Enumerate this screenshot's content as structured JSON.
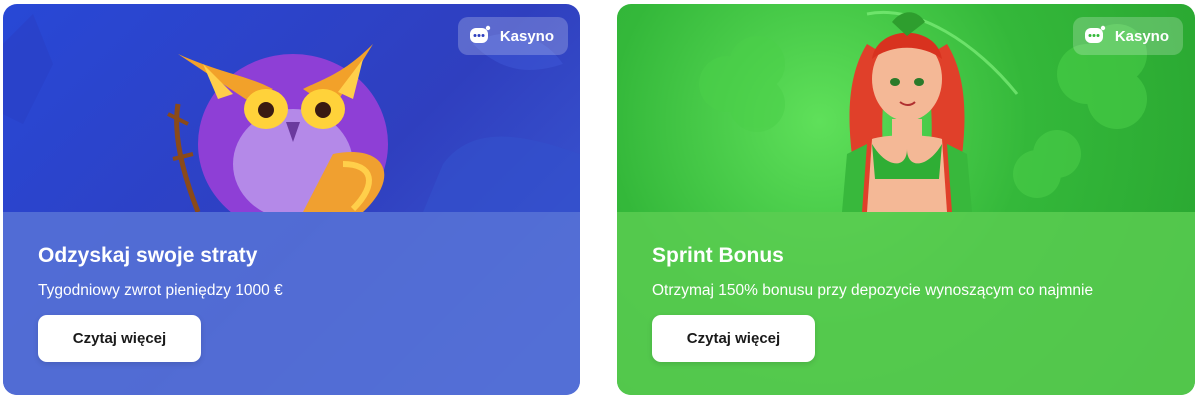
{
  "cards": [
    {
      "badge": "Kasyno",
      "title": "Odzyskaj swoje straty",
      "description": "Tygodniowy zwrot pieniędzy 1000 €",
      "button": "Czytaj więcej"
    },
    {
      "badge": "Kasyno",
      "title": "Sprint Bonus",
      "description": "Otrzymaj 150% bonusu przy depozycie wynoszącym co najmnie",
      "button": "Czytaj więcej"
    }
  ],
  "colors": {
    "card1_bg": "#2f3fbf",
    "card2_bg": "#34b83a",
    "button_bg": "#ffffff"
  },
  "icons": [
    "chat-bubble-icon",
    "owl-illustration",
    "forest-nymph-illustration"
  ]
}
